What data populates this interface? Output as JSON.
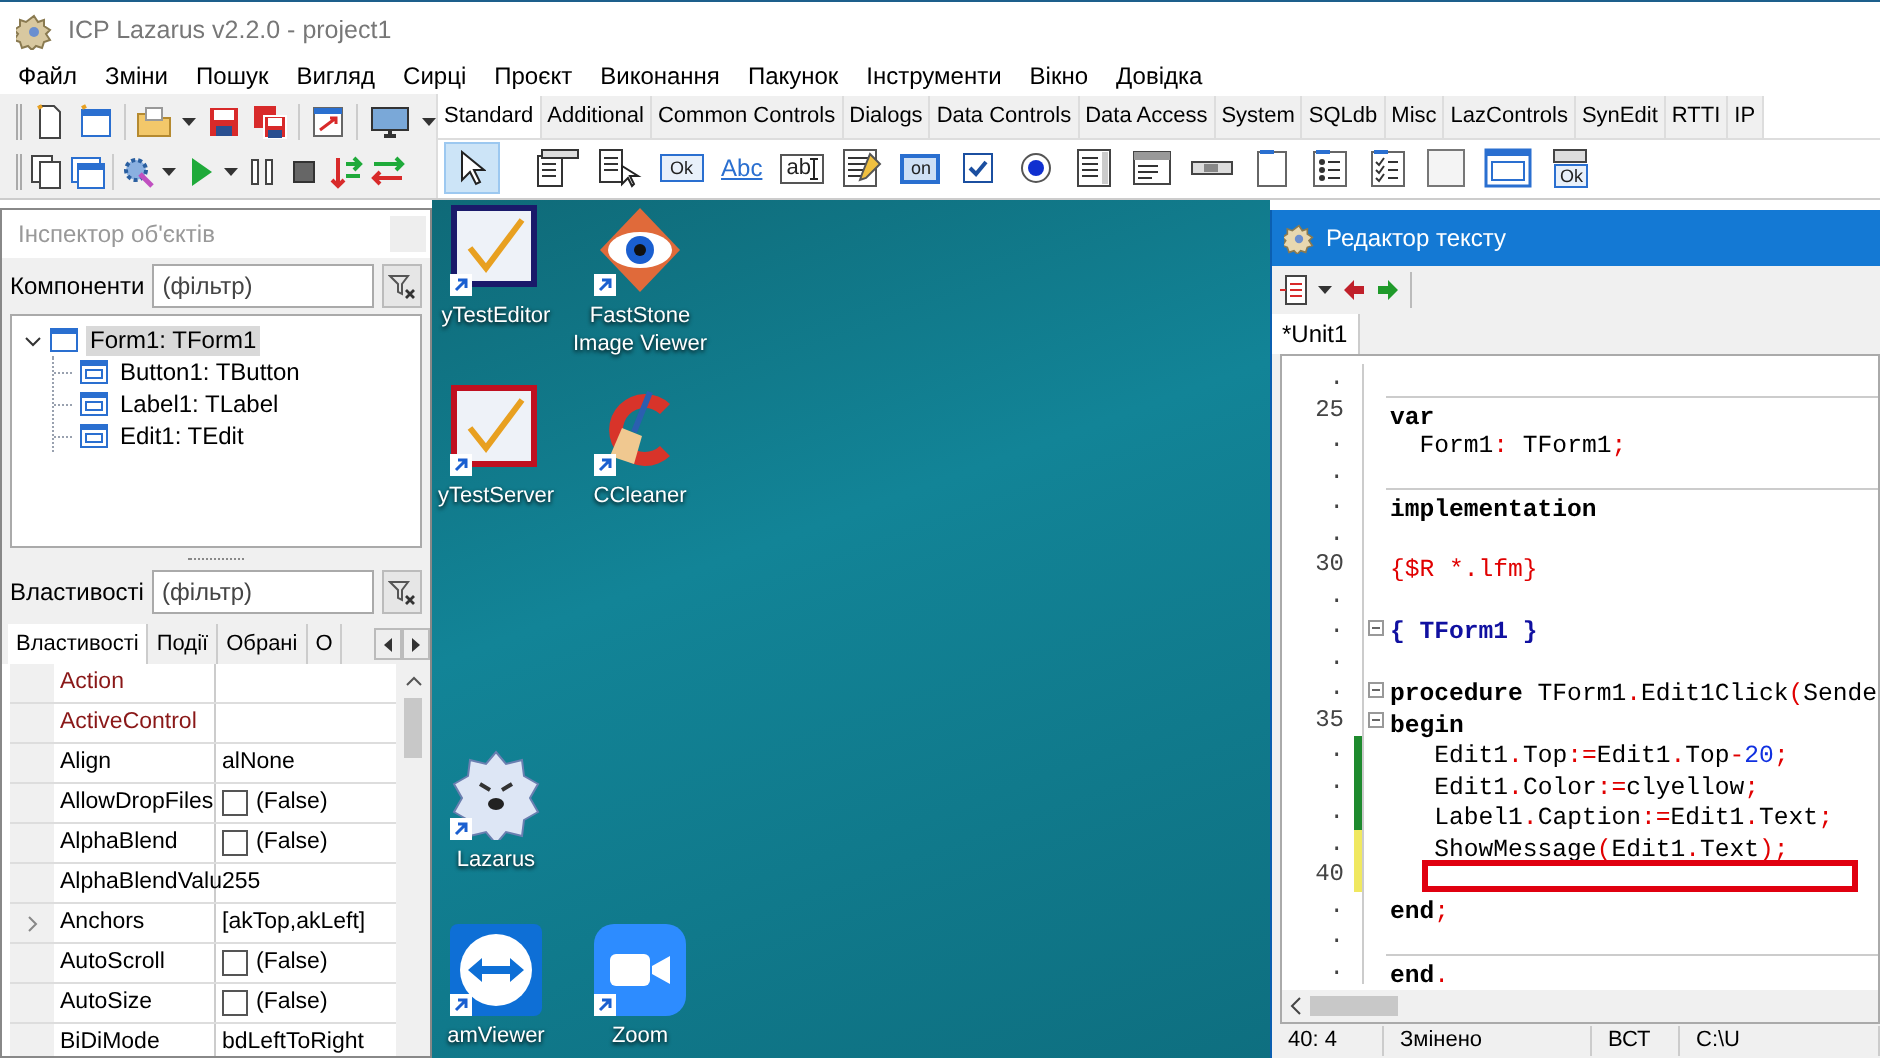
{
  "window": {
    "title": "ICP Lazarus v2.2.0 - project1"
  },
  "menu": [
    "Файл",
    "Зміни",
    "Пошук",
    "Вигляд",
    "Сирці",
    "Проєкт",
    "Виконання",
    "Пакунок",
    "Інструменти",
    "Вікно",
    "Довідка"
  ],
  "palette": {
    "tabs": [
      {
        "label": "Standard",
        "selected": true
      },
      {
        "label": "Additional",
        "selected": false
      },
      {
        "label": "Common Controls",
        "selected": false
      },
      {
        "label": "Dialogs",
        "selected": false
      },
      {
        "label": "Data Controls",
        "selected": false
      },
      {
        "label": "Data Access",
        "selected": false
      },
      {
        "label": "System",
        "selected": false
      },
      {
        "label": "SQLdb",
        "selected": false
      },
      {
        "label": "Misc",
        "selected": false
      },
      {
        "label": "LazControls",
        "selected": false
      },
      {
        "label": "SynEdit",
        "selected": false
      },
      {
        "label": "RTTI",
        "selected": false
      },
      {
        "label": "IP",
        "selected": false
      }
    ],
    "items": [
      {
        "kind": "pointer",
        "selected": true
      },
      {
        "kind": "mainmenu",
        "selected": false
      },
      {
        "kind": "popupmenu",
        "selected": false
      },
      {
        "kind": "button",
        "caption": "Ok",
        "selected": false
      },
      {
        "kind": "label",
        "caption": "Abc",
        "selected": false
      },
      {
        "kind": "edit",
        "caption": "ab",
        "selected": false
      },
      {
        "kind": "memo",
        "selected": false
      },
      {
        "kind": "toggle",
        "caption": "on",
        "selected": false
      },
      {
        "kind": "checkbox",
        "selected": false
      },
      {
        "kind": "radio",
        "selected": false
      },
      {
        "kind": "listbox",
        "selected": false
      },
      {
        "kind": "combobox",
        "selected": false
      },
      {
        "kind": "scrollbar",
        "selected": false
      },
      {
        "kind": "groupbox",
        "selected": false
      },
      {
        "kind": "radiogroup",
        "selected": false
      },
      {
        "kind": "checkgroup",
        "selected": false
      },
      {
        "kind": "panel",
        "selected": false
      },
      {
        "kind": "frame",
        "selected": false
      },
      {
        "kind": "actionlist",
        "caption": "Ok",
        "selected": false
      }
    ]
  },
  "inspector": {
    "title": "Інспектор об'єктів",
    "components_label": "Компоненти",
    "components_filter": {
      "placeholder": "(фільтр)"
    },
    "tree": [
      {
        "label": "Form1: TForm1",
        "expanded": true,
        "selected": true,
        "children": [
          {
            "label": "Button1: TButton",
            "selected": false
          },
          {
            "label": "Label1: TLabel",
            "selected": false
          },
          {
            "label": "Edit1: TEdit",
            "selected": false
          }
        ]
      }
    ],
    "properties_label": "Властивості",
    "properties_filter": {
      "placeholder": "(фільтр)"
    },
    "tabs": [
      {
        "label": "Властивості",
        "selected": true
      },
      {
        "label": "Події",
        "selected": false
      },
      {
        "label": "Обрані",
        "selected": false
      },
      {
        "label": "О",
        "selected": false
      }
    ],
    "properties": [
      {
        "name": "Action",
        "kind": "component"
      },
      {
        "name": "ActiveControl",
        "kind": "component"
      },
      {
        "name": "Align",
        "value": "alNone",
        "kind": "text"
      },
      {
        "name": "AllowDropFiles",
        "value": "(False)",
        "kind": "bool",
        "checked": false
      },
      {
        "name": "AlphaBlend",
        "value": "(False)",
        "kind": "bool",
        "checked": false
      },
      {
        "name": "AlphaBlendValu",
        "value": "255",
        "kind": "text"
      },
      {
        "name": "Anchors",
        "value": "[akTop,akLeft]",
        "kind": "set"
      },
      {
        "name": "AutoScroll",
        "value": "(False)",
        "kind": "bool",
        "checked": false
      },
      {
        "name": "AutoSize",
        "value": "(False)",
        "kind": "bool",
        "checked": false
      },
      {
        "name": "BiDiMode",
        "value": "bdLeftToRight",
        "kind": "text"
      }
    ]
  },
  "desktop": {
    "icons": [
      {
        "label": "yTestEditor",
        "kind": "check-blue"
      },
      {
        "label": "FastStone Image Viewer",
        "kind": "eye"
      },
      {
        "label": "yTestServer",
        "kind": "check-red"
      },
      {
        "label": "CCleaner",
        "kind": "broom"
      },
      {
        "label": "Lazarus",
        "kind": "cheetah"
      },
      {
        "label": "amViewer",
        "kind": "arrows"
      },
      {
        "label": "Zoom",
        "kind": "camera"
      }
    ]
  },
  "editor": {
    "title": "Редактор тексту",
    "tabs": [
      {
        "label": "*Unit1",
        "selected": true
      }
    ],
    "lines": [
      {
        "gutter": "."
      },
      {
        "gutter": "25",
        "segments": [
          {
            "text": "var",
            "kind": "keyword"
          }
        ],
        "divider": true
      },
      {
        "gutter": ".",
        "segments": [
          {
            "text": "  Form1",
            "kind": "ident"
          },
          {
            "text": ":",
            "kind": "symbol"
          },
          {
            "text": " TForm1",
            "kind": "ident"
          },
          {
            "text": ";",
            "kind": "symbol"
          }
        ]
      },
      {
        "gutter": "."
      },
      {
        "gutter": ".",
        "segments": [
          {
            "text": "implementation",
            "kind": "keyword"
          }
        ],
        "divider": true
      },
      {
        "gutter": "."
      },
      {
        "gutter": "30",
        "segments": [
          {
            "text": "{$R *.lfm}",
            "kind": "directive"
          }
        ]
      },
      {
        "gutter": "."
      },
      {
        "gutter": ".",
        "segments": [
          {
            "text": "{ TForm1 }",
            "kind": "comment"
          }
        ],
        "fold": true
      },
      {
        "gutter": "."
      },
      {
        "gutter": ".",
        "segments": [
          {
            "text": "procedure",
            "kind": "keyword"
          },
          {
            "text": " TForm1",
            "kind": "ident"
          },
          {
            "text": ".",
            "kind": "symbol"
          },
          {
            "text": "Edit1Click",
            "kind": "ident"
          },
          {
            "text": "(",
            "kind": "symbol"
          },
          {
            "text": "Sende",
            "kind": "ident"
          }
        ],
        "fold": true
      },
      {
        "gutter": "35",
        "segments": [
          {
            "text": "begin",
            "kind": "keyword"
          }
        ],
        "fold": true
      },
      {
        "gutter": ".",
        "segments": [
          {
            "text": "   Edit1",
            "kind": "ident"
          },
          {
            "text": ".",
            "kind": "symbol"
          },
          {
            "text": "Top",
            "kind": "ident"
          },
          {
            "text": ":=",
            "kind": "symbol"
          },
          {
            "text": "Edit1",
            "kind": "ident"
          },
          {
            "text": ".",
            "kind": "symbol"
          },
          {
            "text": "Top",
            "kind": "ident"
          },
          {
            "text": "-",
            "kind": "symbol"
          },
          {
            "text": "20",
            "kind": "number"
          },
          {
            "text": ";",
            "kind": "symbol"
          }
        ],
        "modified": false
      },
      {
        "gutter": ".",
        "segments": [
          {
            "text": "   Edit1",
            "kind": "ident"
          },
          {
            "text": ".",
            "kind": "symbol"
          },
          {
            "text": "Color",
            "kind": "ident"
          },
          {
            "text": ":=",
            "kind": "symbol"
          },
          {
            "text": "clyellow",
            "kind": "ident"
          },
          {
            "text": ";",
            "kind": "symbol"
          }
        ],
        "modified": false
      },
      {
        "gutter": ".",
        "segments": [
          {
            "text": "   Label1",
            "kind": "ident"
          },
          {
            "text": ".",
            "kind": "symbol"
          },
          {
            "text": "Caption",
            "kind": "ident"
          },
          {
            "text": ":=",
            "kind": "symbol"
          },
          {
            "text": "Edit1",
            "kind": "ident"
          },
          {
            "text": ".",
            "kind": "symbol"
          },
          {
            "text": "Text",
            "kind": "ident"
          },
          {
            "text": ";",
            "kind": "symbol"
          }
        ],
        "modified": false
      },
      {
        "gutter": ".",
        "segments": [
          {
            "text": "   ShowMessage",
            "kind": "ident"
          },
          {
            "text": "(",
            "kind": "symbol"
          },
          {
            "text": "Edit1",
            "kind": "ident"
          },
          {
            "text": ".",
            "kind": "symbol"
          },
          {
            "text": "Text",
            "kind": "ident"
          },
          {
            "text": ");",
            "kind": "symbol"
          }
        ],
        "modified": true
      },
      {
        "gutter": "40",
        "modified": true,
        "boxed": true
      },
      {
        "gutter": ".",
        "segments": [
          {
            "text": "end",
            "kind": "keyword"
          },
          {
            "text": ";",
            "kind": "symbol"
          }
        ]
      },
      {
        "gutter": "."
      },
      {
        "gutter": ".",
        "segments": [
          {
            "text": "end",
            "kind": "keyword"
          },
          {
            "text": ".",
            "kind": "symbol"
          }
        ],
        "divider": true
      }
    ],
    "status": [
      "40: 4",
      "Змінено",
      "ВСТ",
      "C:\\U"
    ]
  }
}
